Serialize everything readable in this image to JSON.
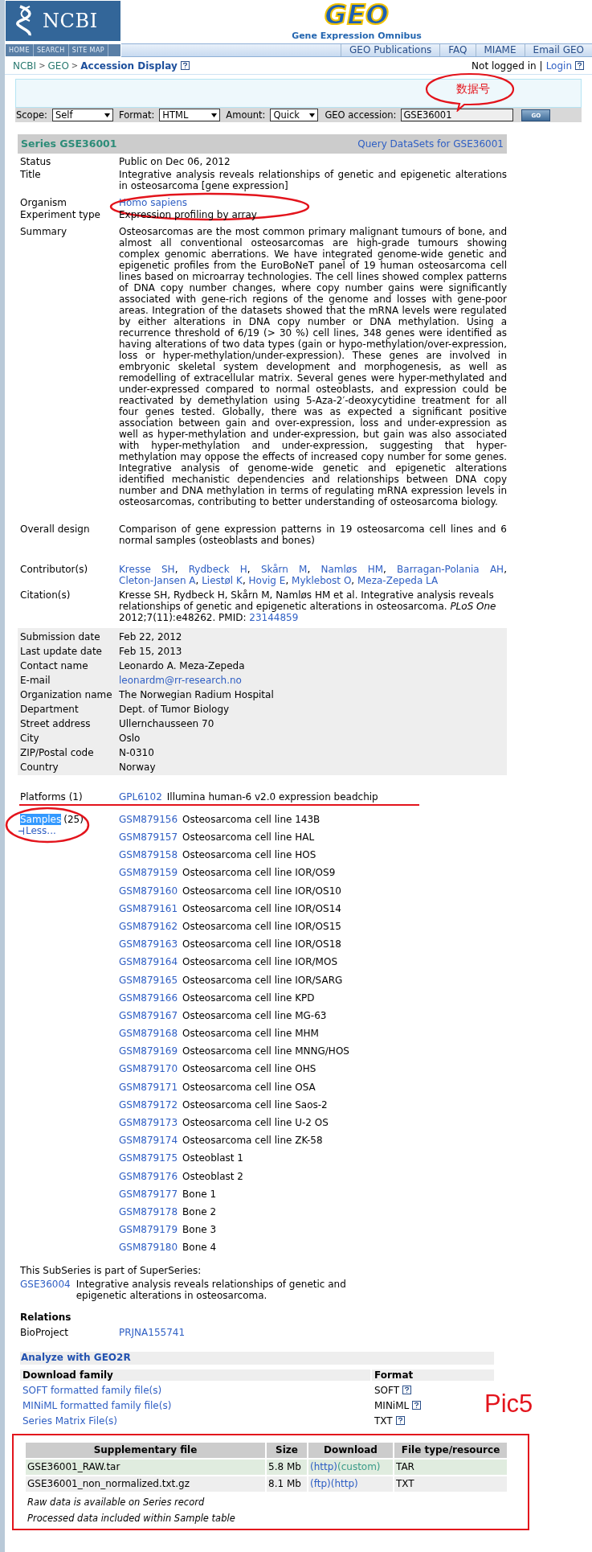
{
  "header": {
    "logo": "NCBI",
    "geo_logo": "GEO",
    "geo_subtitle": "Gene Expression Omnibus",
    "nav_left": [
      "HOME",
      "SEARCH",
      "SITE MAP"
    ],
    "nav_right": [
      "GEO Publications",
      "FAQ",
      "MIAME",
      "Email GEO"
    ]
  },
  "breadcrumb": {
    "items": [
      "NCBI",
      "GEO"
    ],
    "separator": ">",
    "current": "Accession Display",
    "help_icon": true
  },
  "login": {
    "status": "Not logged in",
    "separator": "|",
    "link": "Login",
    "help_icon": true
  },
  "query_form": {
    "selects": [
      {
        "label": "Scope:",
        "value": "Self"
      },
      {
        "label": "Format:",
        "value": "HTML"
      },
      {
        "label": "Amount:",
        "value": "Quick"
      }
    ],
    "accession": {
      "label": "GEO accession:",
      "value": "GSE36001",
      "callout": "数据号"
    },
    "button": "GO"
  },
  "series": {
    "title": "Series GSE36001",
    "query_link": "Query DataSets for GSE36001",
    "fields": [
      {
        "label": "Status",
        "kind": "text",
        "value": "Public on Dec 06, 2012",
        "circled": false
      },
      {
        "label": "Title",
        "kind": "text",
        "value": "Integrative analysis reveals relationships of genetic and epigenetic alterations in osteosarcoma [gene expression]",
        "circled": false
      },
      {
        "label": "Organism",
        "kind": "link",
        "value": "Homo sapiens",
        "circled": true
      },
      {
        "label": "Experiment type",
        "kind": "text",
        "value": "Expression profiling by array",
        "circled": false
      },
      {
        "label": "Summary",
        "kind": "text",
        "value": "Osteosarcomas are the most common primary malignant tumours of bone, and almost all conventional osteosarcomas are high-grade tumours showing complex genomic aberrations. We have integrated genome-wide genetic and epigenetic profiles from the EuroBoNeT panel of 19 human osteosarcoma cell lines based on microarray technologies. The cell lines showed complex patterns of DNA copy number changes, where copy number gains were significantly associated with gene-rich regions of the genome and losses with gene-poor areas. Integration of the datasets showed that the mRNA levels were regulated by either alterations in DNA copy number or DNA methylation. Using a recurrence threshold of 6/19 (> 30 %) cell lines, 348 genes were identified as having alterations of two data types (gain or hypo-methylation/over-expression, loss or hyper-methylation/under-expression). These genes are involved in embryonic skeletal system development and morphogenesis, as well as remodelling of extracellular matrix. Several genes were hyper-methylated and under-expressed compared to normal osteoblasts, and expression could be reactivated by demethylation using 5-Aza-2′-deoxycytidine treatment for all four genes tested. Globally, there was as expected a significant positive association between gain and over-expression, loss and under-expression as well as hyper-methylation and under-expression, but gain was also associated with hyper-methylation and under-expression, suggesting that hyper-methylation may oppose the effects of increased copy number for some genes. Integrative analysis of genome-wide genetic and epigenetic alterations identified mechanistic dependencies and relationships between DNA copy number and DNA methylation in terms of regulating mRNA expression levels in osteosarcomas, contributing to better understanding of osteosarcoma biology.",
        "circled": false
      },
      {
        "label": "Overall design",
        "kind": "text",
        "value": "Comparison of gene expression patterns in 19 osteosarcoma cell lines and 6 normal samples (osteoblasts and bones)",
        "circled": false
      },
      {
        "label": "Contributor(s)",
        "kind": "links",
        "value": [
          "Kresse SH",
          "Rydbeck H",
          "Skårn M",
          "Namløs HM",
          "Barragan-Polania AH",
          "Cleton-Jansen A",
          "Liestøl K",
          "Hovig E",
          "Myklebost O",
          "Meza-Zepeda LA"
        ],
        "separator": ",",
        "circled": false
      },
      {
        "label": "Citation(s)",
        "kind": "citation",
        "value": "Kresse SH, Rydbeck H, Skårn M, Namløs HM et al. Integrative analysis reveals relationships of genetic and epigenetic alterations in osteosarcoma. *PLoS One* 2012;7(11):e48262. PMID:",
        "link": "23144859",
        "circled": false
      }
    ]
  },
  "contact": [
    {
      "label": "Submission date",
      "kind": "text",
      "value": "Feb 22, 2012"
    },
    {
      "label": "Last update date",
      "kind": "text",
      "value": "Feb 15, 2013"
    },
    {
      "label": "Contact name",
      "kind": "text",
      "value": "Leonardo A. Meza-Zepeda"
    },
    {
      "label": "E-mail",
      "kind": "link",
      "value": "leonardm@rr-research.no"
    },
    {
      "label": "Organization name",
      "kind": "text",
      "value": "The Norwegian Radium Hospital"
    },
    {
      "label": "Department",
      "kind": "text",
      "value": "Dept. of Tumor Biology"
    },
    {
      "label": "Street address",
      "kind": "text",
      "value": "Ullernchausseen 70"
    },
    {
      "label": "City",
      "kind": "text",
      "value": "Oslo"
    },
    {
      "label": "ZIP/Postal code",
      "kind": "text",
      "value": "N-0310"
    },
    {
      "label": "Country",
      "kind": "text",
      "value": "Norway"
    }
  ],
  "platforms": {
    "label": "Platforms (1)",
    "underlined": true,
    "items": [
      {
        "id": "GPL6102",
        "title": "Illumina human-6 v2.0 expression beadchip"
      }
    ]
  },
  "samples": {
    "label": "Samples",
    "count": "(25)",
    "highlighted": true,
    "circled": true,
    "toggle": "Less...",
    "items": [
      {
        "id": "GSM879156",
        "title": "Osteosarcoma cell line 143B"
      },
      {
        "id": "GSM879157",
        "title": "Osteosarcoma cell line HAL"
      },
      {
        "id": "GSM879158",
        "title": "Osteosarcoma cell line HOS"
      },
      {
        "id": "GSM879159",
        "title": "Osteosarcoma cell line IOR/OS9"
      },
      {
        "id": "GSM879160",
        "title": "Osteosarcoma cell line IOR/OS10"
      },
      {
        "id": "GSM879161",
        "title": "Osteosarcoma cell line IOR/OS14"
      },
      {
        "id": "GSM879162",
        "title": "Osteosarcoma cell line IOR/OS15"
      },
      {
        "id": "GSM879163",
        "title": "Osteosarcoma cell line IOR/OS18"
      },
      {
        "id": "GSM879164",
        "title": "Osteosarcoma cell line IOR/MOS"
      },
      {
        "id": "GSM879165",
        "title": "Osteosarcoma cell line IOR/SARG"
      },
      {
        "id": "GSM879166",
        "title": "Osteosarcoma cell line KPD"
      },
      {
        "id": "GSM879167",
        "title": "Osteosarcoma cell line MG-63"
      },
      {
        "id": "GSM879168",
        "title": "Osteosarcoma cell line MHM"
      },
      {
        "id": "GSM879169",
        "title": "Osteosarcoma cell line MNNG/HOS"
      },
      {
        "id": "GSM879170",
        "title": "Osteosarcoma cell line OHS"
      },
      {
        "id": "GSM879171",
        "title": "Osteosarcoma cell line OSA"
      },
      {
        "id": "GSM879172",
        "title": "Osteosarcoma cell line Saos-2"
      },
      {
        "id": "GSM879173",
        "title": "Osteosarcoma cell line U-2 OS"
      },
      {
        "id": "GSM879174",
        "title": "Osteosarcoma cell line ZK-58"
      },
      {
        "id": "GSM879175",
        "title": "Osteoblast 1"
      },
      {
        "id": "GSM879176",
        "title": "Osteoblast 2"
      },
      {
        "id": "GSM879177",
        "title": "Bone 1"
      },
      {
        "id": "GSM879178",
        "title": "Bone 2"
      },
      {
        "id": "GSM879179",
        "title": "Bone 3"
      },
      {
        "id": "GSM879180",
        "title": "Bone 4"
      }
    ]
  },
  "superseries": {
    "note": "This SubSeries is part of SuperSeries:",
    "items": [
      {
        "id": "GSE36004",
        "title": "Integrative analysis reveals relationships of genetic and epigenetic alterations in osteosarcoma."
      }
    ]
  },
  "relations": {
    "title": "Relations",
    "items": [
      {
        "label": "BioProject",
        "link": "PRJNA155741"
      }
    ]
  },
  "analyze": "Analyze with GEO2R",
  "download_family": {
    "columns": [
      "Download family",
      "Format"
    ],
    "note": "Pic5",
    "rows": [
      {
        "name": "SOFT formatted family file(s)",
        "format": "SOFT",
        "help_icon": true
      },
      {
        "name": "MINiML formatted family file(s)",
        "format": "MINiML",
        "help_icon": true
      },
      {
        "name": "Series Matrix File(s)",
        "format": "TXT",
        "help_icon": true
      }
    ]
  },
  "supplementary": {
    "framed": true,
    "columns": [
      "Supplementary file",
      "Size",
      "Download",
      "File type/resource"
    ],
    "rows": [
      {
        "file": "GSE36001_RAW.tar",
        "size": "5.8 Mb",
        "links": [
          {
            "text": "(http)",
            "visited": false
          },
          {
            "text": "(custom)",
            "visited": true
          }
        ],
        "type": "TAR",
        "highlighted": true
      },
      {
        "file": "GSE36001_non_normalized.txt.gz",
        "size": "8.1 Mb",
        "links": [
          {
            "text": "(ftp)",
            "visited": false
          },
          {
            "text": "(http)",
            "visited": false
          }
        ],
        "type": "TXT",
        "highlighted": false
      }
    ],
    "notes": [
      "Raw data is available on Series record",
      "Processed data included within Sample table"
    ]
  }
}
